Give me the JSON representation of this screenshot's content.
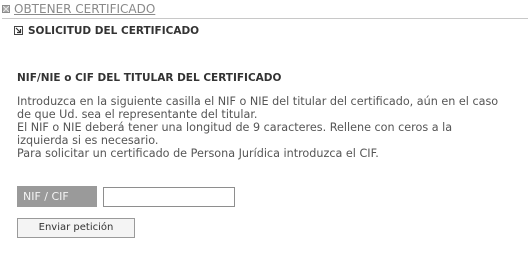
{
  "header": {
    "link_label": "OBTENER CERTIFICADO",
    "icon": "collapse-box-icon"
  },
  "subsection": {
    "title": "SOLICITUD DEL CERTIFICADO",
    "icon": "arrow-box-icon"
  },
  "section": {
    "heading": "NIF/NIE o CIF DEL TITULAR DEL CERTIFICADO",
    "paragraph_lines": [
      "Introduzca en la siguiente casilla el NIF o NIE del titular del certificado, aún en el caso",
      "de que Ud. sea el representante del titular.",
      "El NIF o NIE deberá tener una longitud de 9 caracteres. Rellene con ceros a la",
      "izquierda si es necesario.",
      "Para solicitar un certificado de Persona Jurídica introduzca el CIF."
    ]
  },
  "form": {
    "nif_label": "NIF / CIF",
    "nif_value": "",
    "submit_label": "Enviar petición"
  },
  "colors": {
    "label_background": "#9a9a9a",
    "header_link": "#8a8a8a",
    "body_text": "#555555"
  }
}
